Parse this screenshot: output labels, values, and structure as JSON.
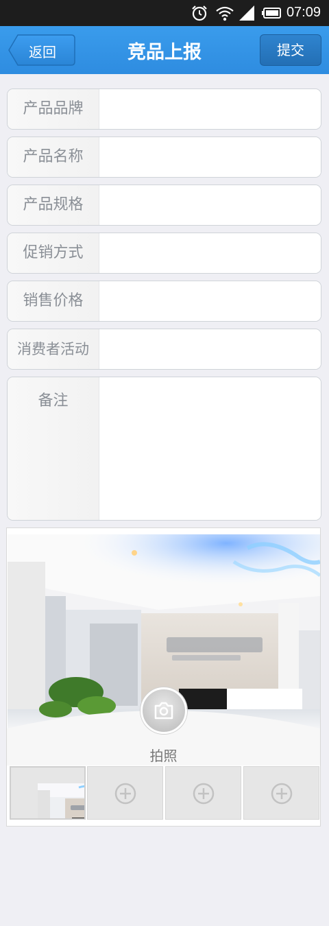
{
  "status_bar": {
    "time": "07:09"
  },
  "nav": {
    "back_label": "返回",
    "title": "竞品上报",
    "submit_label": "提交"
  },
  "form": {
    "fields": [
      {
        "label": "产品品牌",
        "value": ""
      },
      {
        "label": "产品名称",
        "value": ""
      },
      {
        "label": "产品规格",
        "value": ""
      },
      {
        "label": "促销方式",
        "value": ""
      },
      {
        "label": "销售价格",
        "value": ""
      },
      {
        "label": "消费者活动",
        "value": ""
      }
    ],
    "remark": {
      "label": "备注",
      "value": ""
    }
  },
  "photo": {
    "camera_label": "拍照"
  },
  "colors": {
    "nav_bg": "#2f8fe0",
    "page_bg": "#efeff4",
    "status_bg": "#1d1d1d"
  },
  "icons": [
    "alarm-icon",
    "wifi-icon",
    "signal-icon",
    "battery-icon",
    "camera-icon",
    "add-icon"
  ]
}
